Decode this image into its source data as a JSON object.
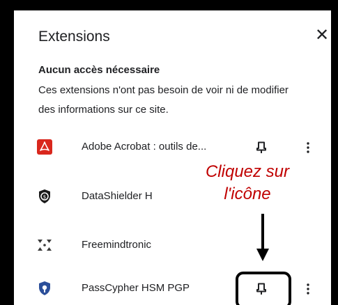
{
  "header": {
    "title": "Extensions",
    "close_glyph": "✕"
  },
  "section": {
    "title": "Aucun accès nécessaire",
    "description": "Ces extensions n'ont pas besoin de voir ni de modifier des informations sur ce site."
  },
  "extensions": [
    {
      "name": "Adobe Acrobat : outils de...",
      "icon": "adobe-acrobat-icon",
      "pin": true,
      "more": true
    },
    {
      "name": "DataShielder H",
      "icon": "datashielder-icon",
      "pin": false,
      "more": false
    },
    {
      "name": "Freemindtronic",
      "icon": "freemindtronic-icon",
      "pin": false,
      "more": false
    },
    {
      "name": "PassCypher HSM PGP",
      "icon": "passcypher-icon",
      "pin": true,
      "more": true
    }
  ],
  "annotation": {
    "line1": "Cliquez sur",
    "line2": "l'icône"
  },
  "colors": {
    "annotation": "#c00000",
    "adobe": "#d9271d",
    "passcypher": "#2b4f9a"
  }
}
